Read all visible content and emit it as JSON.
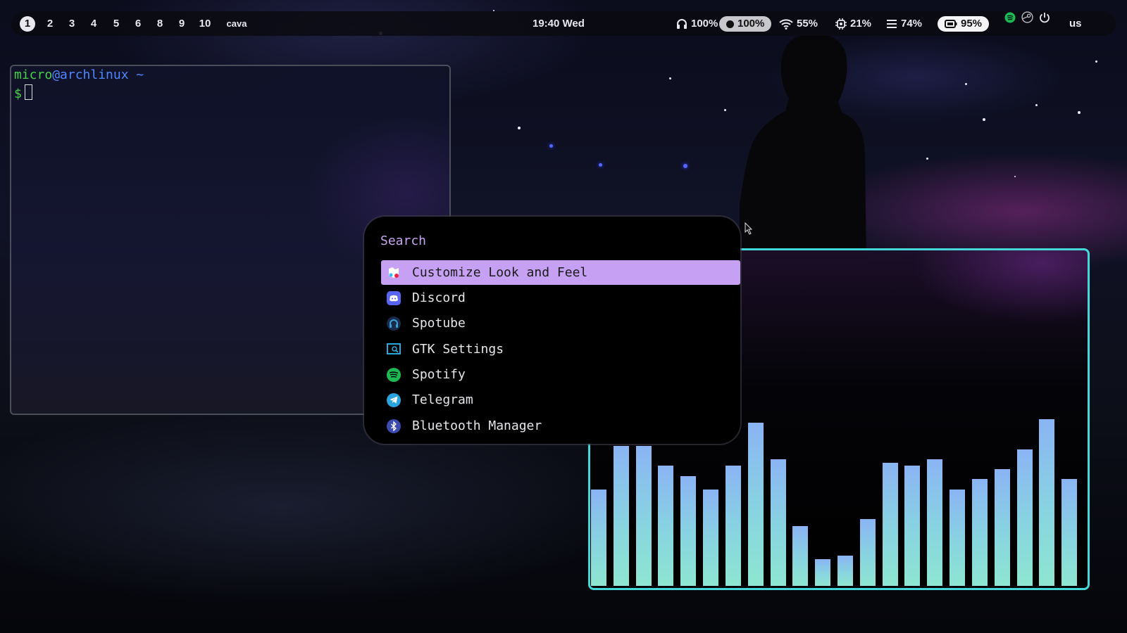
{
  "topbar": {
    "workspaces": [
      "1",
      "2",
      "3",
      "4",
      "5",
      "6",
      "8",
      "9",
      "10",
      "cava"
    ],
    "active_workspace": "1",
    "clock": "19:40 Wed",
    "headphones_volume": "100%",
    "mic_level": "100%",
    "wifi_strength": "55%",
    "cpu_usage": "21%",
    "memory_usage": "74%",
    "battery": "95%",
    "keyboard_layout": "us",
    "tray_icons": [
      "spotify-icon",
      "steam-icon",
      "power-icon"
    ],
    "colors": {
      "bar_bg": "#0a0a10",
      "text": "#e8e8ee",
      "pill_grey": "#c8c8cc",
      "pill_white": "#f4f4f6"
    }
  },
  "terminal": {
    "user": "micro",
    "at": "@",
    "host": "archlinux",
    "path": "~",
    "prompt_symbol": "$",
    "colors": {
      "green": "#4ad04a",
      "blue": "#4f86ff",
      "border": "#4a4d5a"
    }
  },
  "launcher": {
    "search_placeholder": "Search",
    "selected_index": 0,
    "items": [
      {
        "label": "Customize Look and Feel",
        "icon": "customize-icon"
      },
      {
        "label": "Discord",
        "icon": "discord-icon"
      },
      {
        "label": "Spotube",
        "icon": "spotube-icon"
      },
      {
        "label": "GTK Settings",
        "icon": "gtk-settings-icon"
      },
      {
        "label": "Spotify",
        "icon": "spotify-icon"
      },
      {
        "label": "Telegram",
        "icon": "telegram-icon"
      },
      {
        "label": "Bluetooth Manager",
        "icon": "bluetooth-icon"
      }
    ],
    "colors": {
      "accent": "#c6a0f2",
      "text": "#e6e6ea",
      "bg": "#000000"
    }
  },
  "cava": {
    "levels": [
      0.29,
      0.42,
      0.42,
      0.36,
      0.33,
      0.29,
      0.36,
      0.49,
      0.38,
      0.18,
      0.08,
      0.09,
      0.2,
      0.37,
      0.36,
      0.38,
      0.29,
      0.32,
      0.35,
      0.41,
      0.5,
      0.32
    ],
    "colors": {
      "border": "#46d8d8",
      "bar_top": "#8ab4f4",
      "bar_bottom": "#8ee6d0"
    }
  }
}
